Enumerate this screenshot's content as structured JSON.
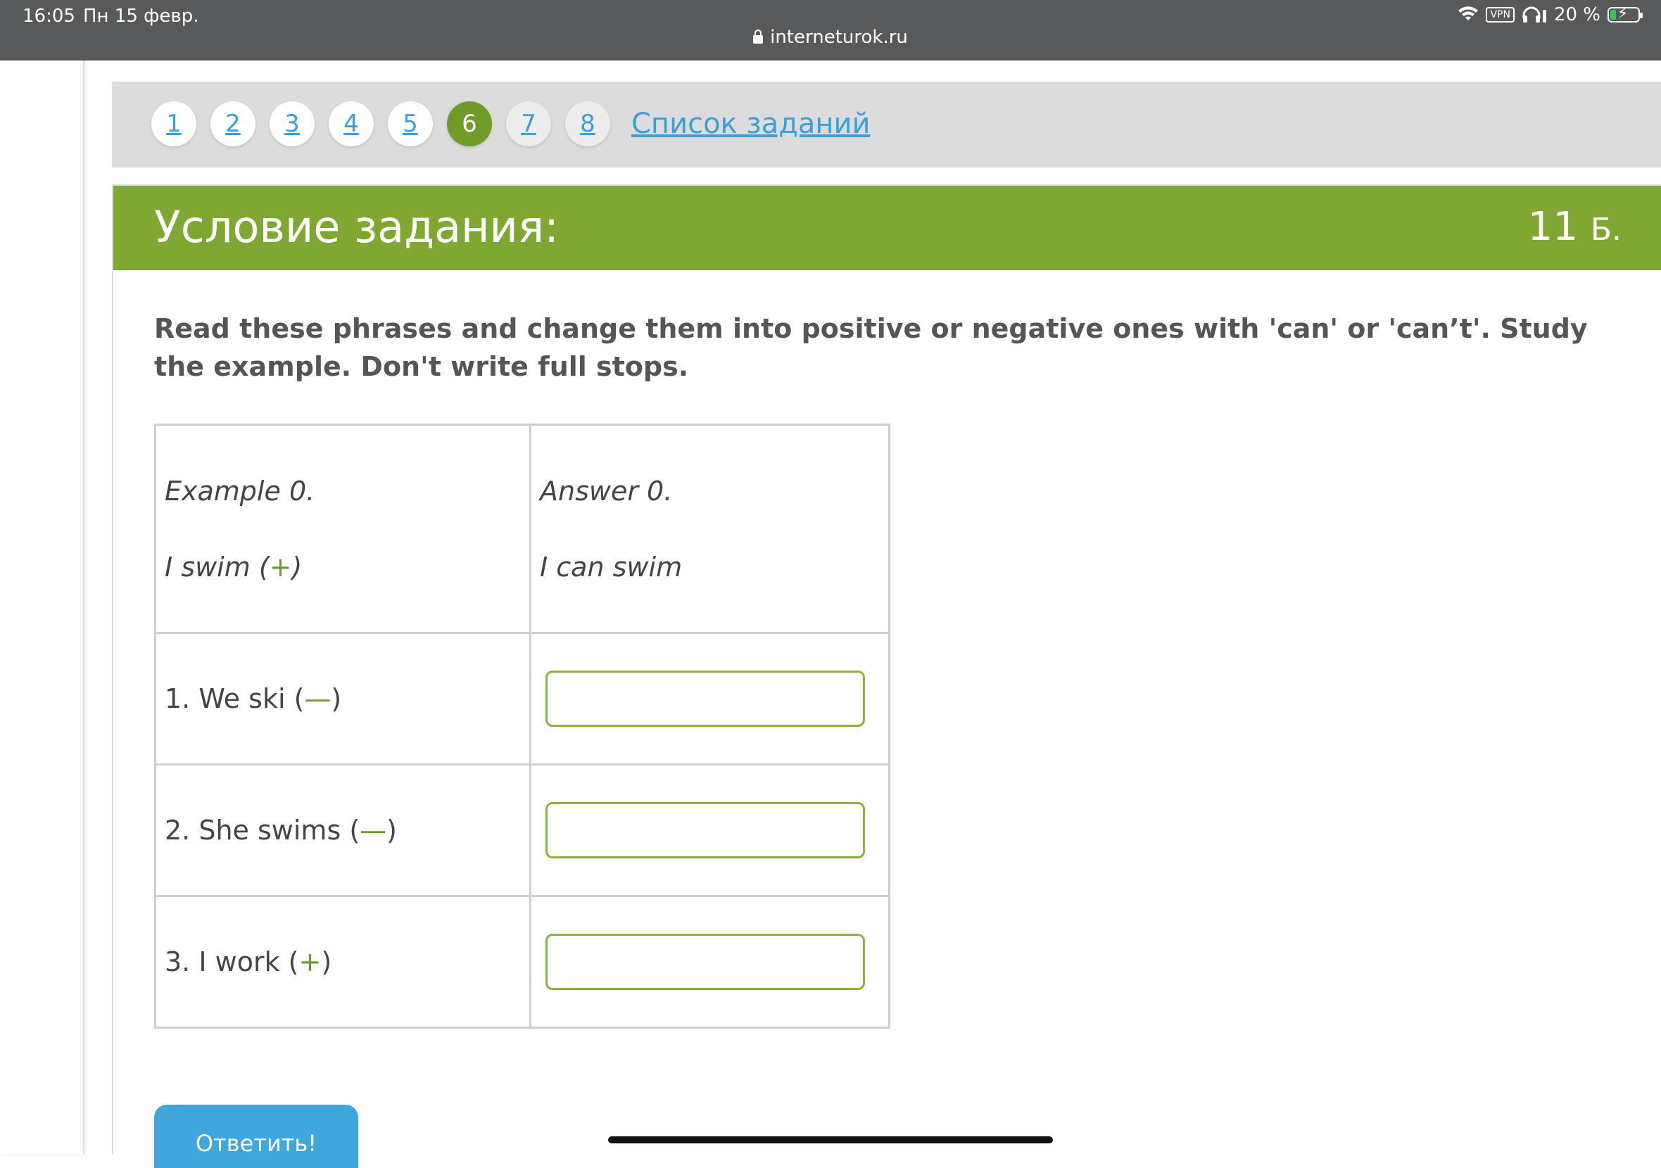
{
  "status_bar": {
    "time": "16:05",
    "date": "Пн 15 февр.",
    "vpn": "VPN",
    "battery": "20 %",
    "battery_level": 0.2,
    "url": "interneturok.ru"
  },
  "task_nav": {
    "items": [
      {
        "label": "1",
        "state": "done"
      },
      {
        "label": "2",
        "state": "done"
      },
      {
        "label": "3",
        "state": "done"
      },
      {
        "label": "4",
        "state": "done"
      },
      {
        "label": "5",
        "state": "done"
      },
      {
        "label": "6",
        "state": "active"
      },
      {
        "label": "7",
        "state": "pending"
      },
      {
        "label": "8",
        "state": "pending"
      }
    ],
    "list_link": "Список заданий"
  },
  "task": {
    "title": "Условие задания:",
    "points": "11",
    "points_unit": "Б.",
    "instructions": "Read these phrases and change them into positive or negative ones with 'can' or 'can’t'. Study the example. Don't write full stops.",
    "example": {
      "label": "Example 0.",
      "phrase": "I swim (",
      "sign": "+",
      "close": ")",
      "answer_label": "Answer 0.",
      "answer": "I can swim"
    },
    "items": [
      {
        "phrase": "1. We ski (",
        "sign": "—",
        "close": ")",
        "value": ""
      },
      {
        "phrase": "2. She swims (",
        "sign": "—",
        "close": ")",
        "value": ""
      },
      {
        "phrase": "3. I work (",
        "sign": "+",
        "close": ")",
        "value": ""
      }
    ],
    "submit_label": "Ответить!"
  },
  "colors": {
    "accent_green": "#7ea832",
    "link_blue": "#3aa0d9",
    "button_blue": "#3fa7dc"
  }
}
